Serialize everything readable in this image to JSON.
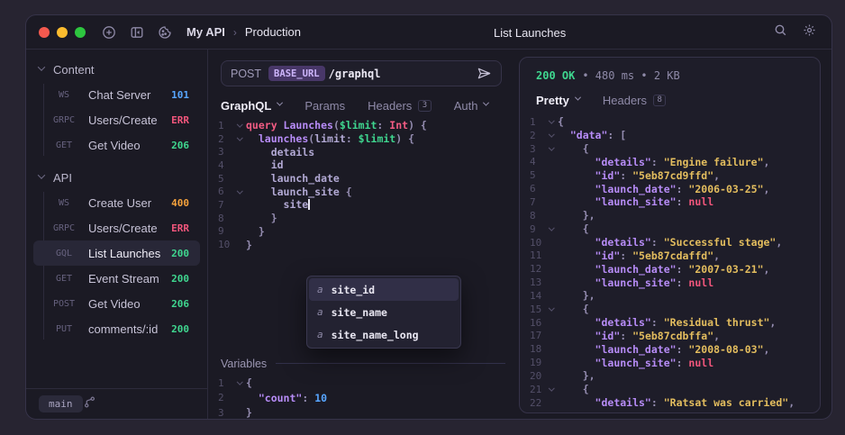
{
  "window": {
    "traffic_lights": [
      "close",
      "minimize",
      "zoom"
    ],
    "toolbar_icons": [
      "plus-circle-icon",
      "panel-left-icon",
      "cookie-icon"
    ],
    "breadcrumb": {
      "workspace": "My API",
      "separator": "›",
      "environment": "Production"
    },
    "title": "List Launches",
    "right_icons": [
      "search-icon",
      "gear-icon"
    ]
  },
  "sidebar": {
    "sections": [
      {
        "label": "Content",
        "items": [
          {
            "method": "WS",
            "name": "Chat Server",
            "status": "101",
            "color": "blue"
          },
          {
            "method": "GRPC",
            "name": "Users/Create",
            "status": "ERR",
            "color": "red"
          },
          {
            "method": "GET",
            "name": "Get Video",
            "status": "206",
            "color": "green"
          }
        ]
      },
      {
        "label": "API",
        "items": [
          {
            "method": "WS",
            "name": "Create User",
            "status": "400",
            "color": "orange"
          },
          {
            "method": "GRPC",
            "name": "Users/Create",
            "status": "ERR",
            "color": "red"
          },
          {
            "method": "GQL",
            "name": "List Launches",
            "status": "200",
            "color": "green",
            "selected": true
          },
          {
            "method": "GET",
            "name": "Event Stream",
            "status": "200",
            "color": "green"
          },
          {
            "method": "POST",
            "name": "Get Video",
            "status": "206",
            "color": "green"
          },
          {
            "method": "PUT",
            "name": "comments/:id",
            "status": "200",
            "color": "green"
          }
        ]
      }
    ],
    "footer": {
      "branch": "main",
      "icon": "git-branch-icon"
    }
  },
  "request": {
    "method": "POST",
    "env_var": "BASE_URL",
    "path": "/graphql",
    "send_icon": "send-icon",
    "tabs": [
      {
        "label": "GraphQL",
        "chevron": true,
        "active": true
      },
      {
        "label": "Params"
      },
      {
        "label": "Headers",
        "badge": "3"
      },
      {
        "label": "Auth",
        "chevron": true
      }
    ],
    "query_lines": [
      {
        "n": "1",
        "chev": true,
        "t": [
          {
            "c": "kw",
            "v": "query "
          },
          {
            "c": "fn",
            "v": "Launches"
          },
          {
            "c": "p",
            "v": "("
          },
          {
            "c": "vr",
            "v": "$limit"
          },
          {
            "c": "p",
            "v": ": "
          },
          {
            "c": "kw",
            "v": "Int"
          },
          {
            "c": "p",
            "v": ") {"
          }
        ]
      },
      {
        "n": "2",
        "chev": true,
        "t": [
          {
            "c": "p",
            "v": "  "
          },
          {
            "c": "fn",
            "v": "launches"
          },
          {
            "c": "p",
            "v": "("
          },
          {
            "c": "id",
            "v": "limit"
          },
          {
            "c": "p",
            "v": ": "
          },
          {
            "c": "vr",
            "v": "$limit"
          },
          {
            "c": "p",
            "v": ") {"
          }
        ]
      },
      {
        "n": "3",
        "t": [
          {
            "c": "id",
            "v": "    details"
          }
        ]
      },
      {
        "n": "4",
        "t": [
          {
            "c": "id",
            "v": "    id"
          }
        ]
      },
      {
        "n": "5",
        "t": [
          {
            "c": "id",
            "v": "    launch_date"
          }
        ]
      },
      {
        "n": "6",
        "chev": true,
        "t": [
          {
            "c": "id",
            "v": "    launch_site "
          },
          {
            "c": "p",
            "v": "{"
          }
        ]
      },
      {
        "n": "7",
        "caret": true,
        "t": [
          {
            "c": "id",
            "v": "      site"
          }
        ]
      },
      {
        "n": "8",
        "t": [
          {
            "c": "p",
            "v": "    }"
          }
        ]
      },
      {
        "n": "9",
        "t": [
          {
            "c": "p",
            "v": "  }"
          }
        ]
      },
      {
        "n": "10",
        "t": [
          {
            "c": "p",
            "v": "}"
          }
        ]
      }
    ],
    "autocomplete": [
      {
        "kind": "a",
        "label": "site_id",
        "selected": true
      },
      {
        "kind": "a",
        "label": "site_name"
      },
      {
        "kind": "a",
        "label": "site_name_long"
      }
    ],
    "variables": {
      "label": "Variables",
      "lines": [
        {
          "n": "1",
          "chev": true,
          "t": [
            {
              "c": "p",
              "v": "{"
            }
          ]
        },
        {
          "n": "2",
          "t": [
            {
              "c": "p",
              "v": "  "
            },
            {
              "c": "key",
              "v": "\"count\""
            },
            {
              "c": "p",
              "v": ": "
            },
            {
              "c": "num",
              "v": "10"
            }
          ]
        },
        {
          "n": "3",
          "t": [
            {
              "c": "p",
              "v": "}"
            }
          ]
        }
      ]
    }
  },
  "response": {
    "status_text": "200 OK",
    "meta_text": "• 480 ms • 2 KB",
    "tabs": [
      {
        "label": "Pretty",
        "chevron": true,
        "active": true
      },
      {
        "label": "Headers",
        "badge": "8"
      }
    ],
    "body_lines": [
      {
        "n": "1",
        "chev": true,
        "t": [
          {
            "c": "p",
            "v": "{"
          }
        ]
      },
      {
        "n": "2",
        "chev": true,
        "t": [
          {
            "c": "p",
            "v": "  "
          },
          {
            "c": "key",
            "v": "\"data\""
          },
          {
            "c": "p",
            "v": ": ["
          }
        ]
      },
      {
        "n": "3",
        "chev": true,
        "t": [
          {
            "c": "p",
            "v": "    {"
          }
        ]
      },
      {
        "n": "4",
        "t": [
          {
            "c": "p",
            "v": "      "
          },
          {
            "c": "key",
            "v": "\"details\""
          },
          {
            "c": "p",
            "v": ": "
          },
          {
            "c": "str",
            "v": "\"Engine failure\""
          },
          {
            "c": "p",
            "v": ","
          }
        ]
      },
      {
        "n": "5",
        "t": [
          {
            "c": "p",
            "v": "      "
          },
          {
            "c": "key",
            "v": "\"id\""
          },
          {
            "c": "p",
            "v": ": "
          },
          {
            "c": "str",
            "v": "\"5eb87cd9ffd\""
          },
          {
            "c": "p",
            "v": ","
          }
        ]
      },
      {
        "n": "6",
        "t": [
          {
            "c": "p",
            "v": "      "
          },
          {
            "c": "key",
            "v": "\"launch_date\""
          },
          {
            "c": "p",
            "v": ": "
          },
          {
            "c": "str",
            "v": "\"2006-03-25\""
          },
          {
            "c": "p",
            "v": ","
          }
        ]
      },
      {
        "n": "7",
        "t": [
          {
            "c": "p",
            "v": "      "
          },
          {
            "c": "key",
            "v": "\"launch_site\""
          },
          {
            "c": "p",
            "v": ": "
          },
          {
            "c": "null",
            "v": "null"
          }
        ]
      },
      {
        "n": "8",
        "t": [
          {
            "c": "p",
            "v": "    },"
          }
        ]
      },
      {
        "n": "9",
        "chev": true,
        "t": [
          {
            "c": "p",
            "v": "    {"
          }
        ]
      },
      {
        "n": "10",
        "t": [
          {
            "c": "p",
            "v": "      "
          },
          {
            "c": "key",
            "v": "\"details\""
          },
          {
            "c": "p",
            "v": ": "
          },
          {
            "c": "str",
            "v": "\"Successful stage\""
          },
          {
            "c": "p",
            "v": ","
          }
        ]
      },
      {
        "n": "11",
        "t": [
          {
            "c": "p",
            "v": "      "
          },
          {
            "c": "key",
            "v": "\"id\""
          },
          {
            "c": "p",
            "v": ": "
          },
          {
            "c": "str",
            "v": "\"5eb87cdaffd\""
          },
          {
            "c": "p",
            "v": ","
          }
        ]
      },
      {
        "n": "12",
        "t": [
          {
            "c": "p",
            "v": "      "
          },
          {
            "c": "key",
            "v": "\"launch_date\""
          },
          {
            "c": "p",
            "v": ": "
          },
          {
            "c": "str",
            "v": "\"2007-03-21\""
          },
          {
            "c": "p",
            "v": ","
          }
        ]
      },
      {
        "n": "13",
        "t": [
          {
            "c": "p",
            "v": "      "
          },
          {
            "c": "key",
            "v": "\"launch_site\""
          },
          {
            "c": "p",
            "v": ": "
          },
          {
            "c": "null",
            "v": "null"
          }
        ]
      },
      {
        "n": "14",
        "t": [
          {
            "c": "p",
            "v": "    },"
          }
        ]
      },
      {
        "n": "15",
        "chev": true,
        "t": [
          {
            "c": "p",
            "v": "    {"
          }
        ]
      },
      {
        "n": "16",
        "t": [
          {
            "c": "p",
            "v": "      "
          },
          {
            "c": "key",
            "v": "\"details\""
          },
          {
            "c": "p",
            "v": ": "
          },
          {
            "c": "str",
            "v": "\"Residual thrust\""
          },
          {
            "c": "p",
            "v": ","
          }
        ]
      },
      {
        "n": "17",
        "t": [
          {
            "c": "p",
            "v": "      "
          },
          {
            "c": "key",
            "v": "\"id\""
          },
          {
            "c": "p",
            "v": ": "
          },
          {
            "c": "str",
            "v": "\"5eb87cdbffa\""
          },
          {
            "c": "p",
            "v": ","
          }
        ]
      },
      {
        "n": "18",
        "t": [
          {
            "c": "p",
            "v": "      "
          },
          {
            "c": "key",
            "v": "\"launch_date\""
          },
          {
            "c": "p",
            "v": ": "
          },
          {
            "c": "str",
            "v": "\"2008-08-03\""
          },
          {
            "c": "p",
            "v": ","
          }
        ]
      },
      {
        "n": "19",
        "t": [
          {
            "c": "p",
            "v": "      "
          },
          {
            "c": "key",
            "v": "\"launch_site\""
          },
          {
            "c": "p",
            "v": ": "
          },
          {
            "c": "null",
            "v": "null"
          }
        ]
      },
      {
        "n": "20",
        "t": [
          {
            "c": "p",
            "v": "    },"
          }
        ]
      },
      {
        "n": "21",
        "chev": true,
        "t": [
          {
            "c": "p",
            "v": "    {"
          }
        ]
      },
      {
        "n": "22",
        "t": [
          {
            "c": "p",
            "v": "      "
          },
          {
            "c": "key",
            "v": "\"details\""
          },
          {
            "c": "p",
            "v": ": "
          },
          {
            "c": "str",
            "v": "\"Ratsat was carried\""
          },
          {
            "c": "p",
            "v": ","
          }
        ]
      }
    ]
  },
  "colors": {
    "accent_purple": "#b78cf7",
    "green": "#3fd68f",
    "pink": "#f2567c",
    "blue": "#58a6ff",
    "orange": "#f5a23c",
    "yellow": "#e3bd5e",
    "env_badge_bg": "#483768",
    "window_bg": "#1b1a24",
    "page_bg": "#272431"
  }
}
